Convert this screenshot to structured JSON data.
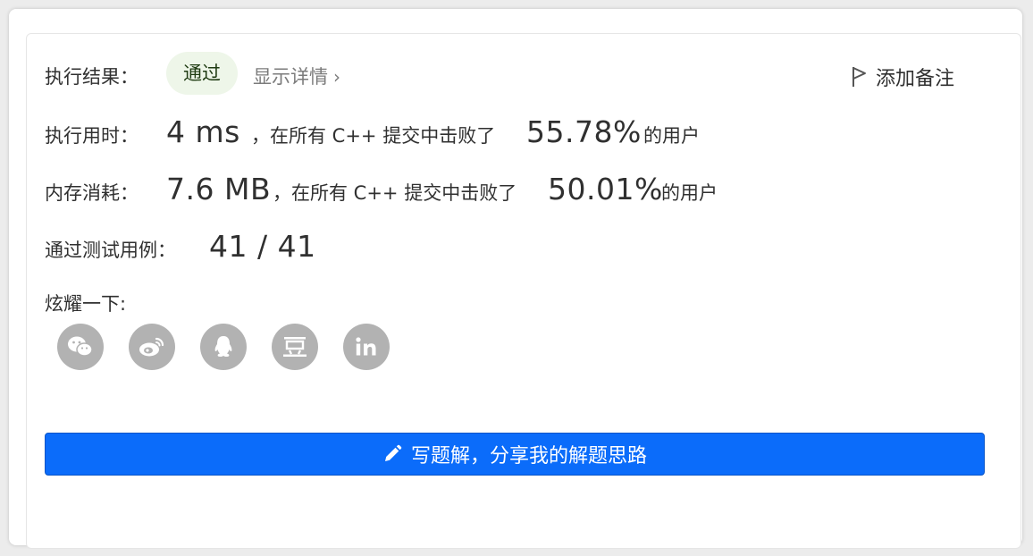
{
  "result": {
    "label": "执行结果：",
    "status": "通过",
    "details_link": "显示详情",
    "add_note": "添加备注"
  },
  "runtime": {
    "label": "执行用时：",
    "value": "4 ms",
    "text_before": "，在所有 C++ 提交中击败了",
    "percent": "55.78%",
    "text_after": "的用户"
  },
  "memory": {
    "label": "内存消耗：",
    "value": "7.6 MB",
    "text_before": "，在所有 C++ 提交中击败了",
    "percent": "50.01%",
    "text_after": "的用户"
  },
  "testcases": {
    "label": "通过测试用例：",
    "value": "41 / 41"
  },
  "share": {
    "label": "炫耀一下:",
    "icons": [
      "wechat-icon",
      "weibo-icon",
      "qq-icon",
      "douban-icon",
      "linkedin-icon"
    ]
  },
  "write_solution": {
    "label": "写题解，分享我的解题思路"
  },
  "colors": {
    "primary_button": "#0b6cfa",
    "pass_bg": "#eef6e9",
    "share_icon_bg": "#b2b2b2"
  }
}
